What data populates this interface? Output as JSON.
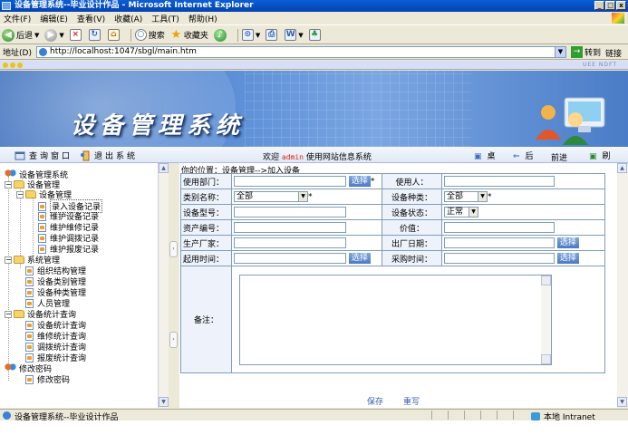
{
  "window": {
    "title": "设备管理系统--毕业设计作品 - Microsoft Internet Explorer",
    "buttons": [
      "_",
      "□",
      "x"
    ]
  },
  "menu": [
    "文件(F)",
    "编辑(E)",
    "查看(V)",
    "收藏(A)",
    "工具(T)",
    "帮助(H)"
  ],
  "toolbar": {
    "back": "后退",
    "search": "搜索",
    "favorites": "收藏夹"
  },
  "address": {
    "label": "地址(D)",
    "url": "http://localhost:1047/sbgl/main.htm",
    "go": "转到",
    "links": "链接"
  },
  "strip": {
    "right": "UEE NDFT"
  },
  "banner": {
    "title": "设备管理系统"
  },
  "nav": {
    "left": "查询窗口",
    "logout": "退出系统",
    "welcome_prefix": "欢迎",
    "username": "admin",
    "welcome_suffix": "使用网站信息系统",
    "desktop": "桌面",
    "back": "后退",
    "forward": "前进",
    "refresh": "刷新"
  },
  "tree": {
    "root": "设备管理系统",
    "group1": "设备管理",
    "group1_sub": "设备管理",
    "items1": [
      "录入设备记录",
      "维护设备记录",
      "维护维修记录",
      "维护调拨记录",
      "维护报废记录"
    ],
    "group2": "系统管理",
    "items2": [
      "组织结构管理",
      "设备类别管理",
      "设备种类管理",
      "人员管理"
    ],
    "group3": "设备统计查询",
    "items3": [
      "设备统计查询",
      "维修统计查询",
      "调拨统计查询",
      "报废统计查询"
    ],
    "group4": "修改密码",
    "items4": [
      "修改密码"
    ]
  },
  "form": {
    "breadcrumb": "你的位置：设备管理-->加入设备",
    "dept_label": "使用部门：",
    "select_btn": "选择",
    "user_label": "使用人：",
    "category_label": "类别名称：",
    "category_value": "全部",
    "kind_label": "设备种类：",
    "kind_value": "全部",
    "model_label": "设备型号：",
    "status_label": "设备状态：",
    "status_value": "正常",
    "asset_label": "资产编号：",
    "price_label": "价值：",
    "maker_label": "生产厂家：",
    "date_label": "出厂日期：",
    "start_label": "起用时间：",
    "purchase_label": "采购时间：",
    "note_label": "备注：",
    "required": "*",
    "save": "保存",
    "reset": "重写"
  },
  "status": {
    "text": "设备管理系统--毕业设计作品",
    "zone": "本地 Intranet"
  }
}
